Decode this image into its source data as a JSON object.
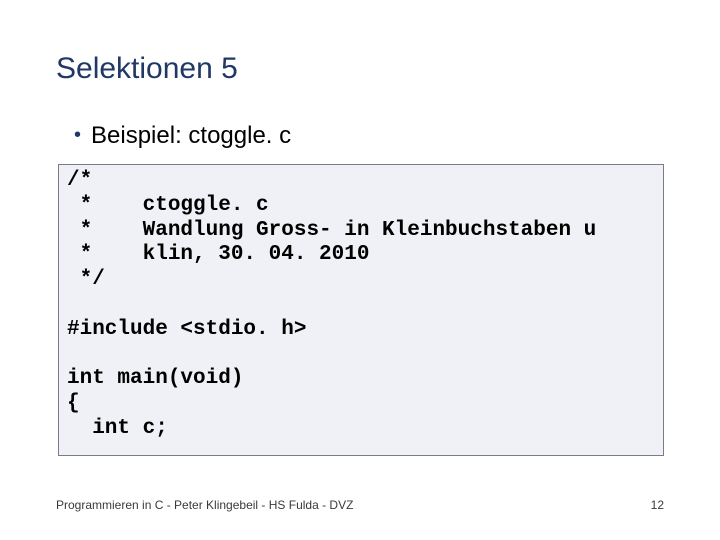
{
  "title": "Selektionen 5",
  "bullet": "Beispiel: ctoggle. c",
  "code": "/*\n *    ctoggle. c\n *    Wandlung Gross- in Kleinbuchstaben u\n *    klin, 30. 04. 2010\n */\n\n#include <stdio. h>\n\nint main(void)\n{\n  int c;",
  "footer": "Programmieren in C - Peter Klingebeil - HS Fulda - DVZ",
  "page": "12"
}
